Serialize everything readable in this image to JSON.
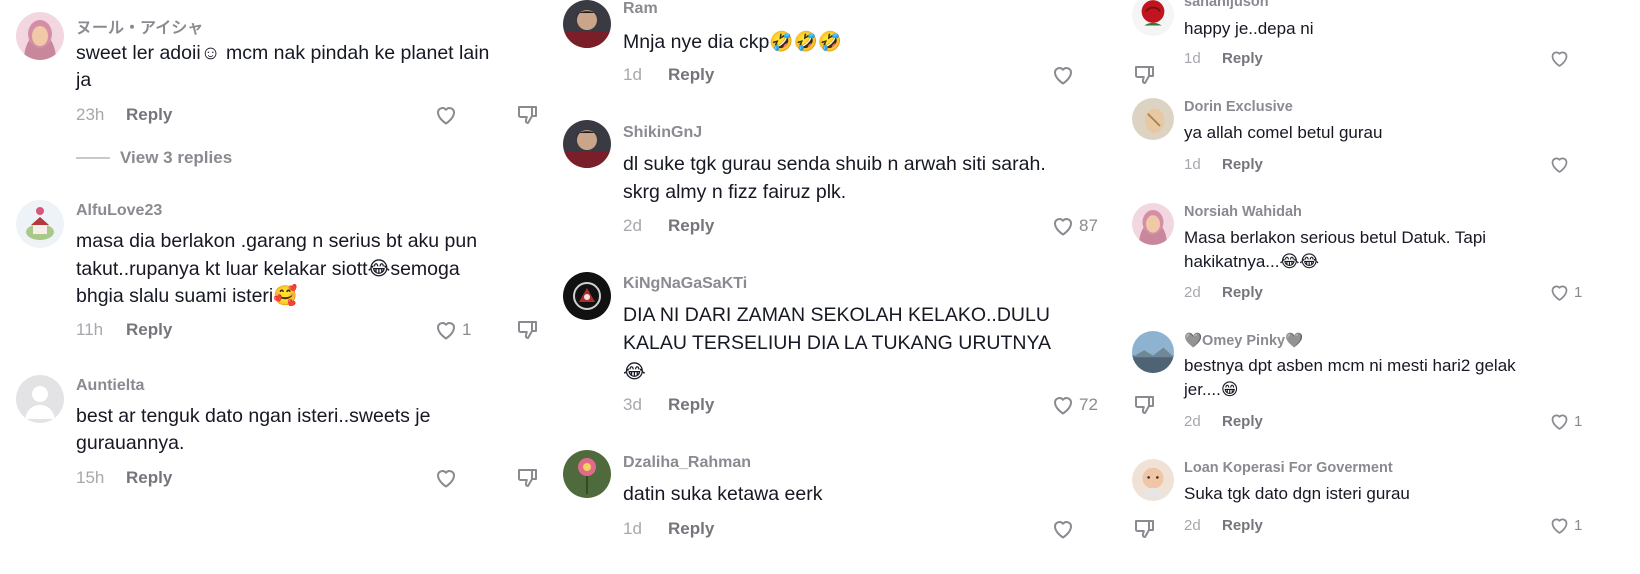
{
  "columns": [
    {
      "comments": [
        {
          "username": "ヌール・アイシャ",
          "lines": [
            "sweet ler adoii☺ mcm nak pindah ke planet lain",
            "ja"
          ],
          "time": "23h",
          "reply": "Reply",
          "likes": "",
          "view_replies": "View 3 replies",
          "avatar": "hijab-avatar"
        },
        {
          "username": "AlfuLove23",
          "lines": [
            "masa dia berlakon .garang n serius bt aku pun",
            "takut..rupanya kt luar kelakar siott😂semoga",
            "bhgia slalu suami isteri🥰"
          ],
          "time": "11h",
          "reply": "Reply",
          "likes": "1",
          "avatar": "house-avatar"
        },
        {
          "username": "Auntielta",
          "lines": [
            "best ar tenguk dato ngan isteri..sweets je",
            "gurauannya."
          ],
          "time": "15h",
          "reply": "Reply",
          "likes": "",
          "avatar": "default-avatar"
        }
      ]
    },
    {
      "comments": [
        {
          "username": "Ram",
          "lines": [
            "Mnja nye dia ckp🤣🤣🤣"
          ],
          "time": "1d",
          "reply": "Reply",
          "likes": "",
          "avatar": "person-avatar"
        },
        {
          "username": "ShikinGnJ",
          "lines": [
            "dl suke tgk gurau senda shuib n arwah siti sarah.",
            "skrg almy n fizz fairuz plk."
          ],
          "time": "2d",
          "reply": "Reply",
          "likes": "87",
          "avatar": "person-avatar"
        },
        {
          "username": "KiNgNaGaSaKTi",
          "lines": [
            "DIA NI DARI ZAMAN SEKOLAH KELAKO..DULU",
            "KALAU TERSELIUH DIA LA TUKANG URUTNYA",
            "😂"
          ],
          "time": "3d",
          "reply": "Reply",
          "likes": "72",
          "avatar": "logo-avatar"
        },
        {
          "username": "Dzaliha_Rahman",
          "lines": [
            "datin suka ketawa eerk"
          ],
          "time": "1d",
          "reply": "Reply",
          "likes": "",
          "avatar": "flower-avatar"
        }
      ]
    },
    {
      "comments": [
        {
          "username": "sahanijuson",
          "lines": [
            "happy je..depa ni"
          ],
          "time": "1d",
          "reply": "Reply",
          "likes": "",
          "avatar": "rose-avatar"
        },
        {
          "username": "Dorin Exclusive",
          "lines": [
            "ya allah comel betul gurau"
          ],
          "time": "1d",
          "reply": "Reply",
          "likes": "",
          "avatar": "hand-avatar"
        },
        {
          "username": "Norsiah Wahidah",
          "lines": [
            "Masa berlakon serious betul Datuk. Tapi",
            "hakikatnya...😂😂"
          ],
          "time": "2d",
          "reply": "Reply",
          "likes": "1",
          "avatar": "hijab-avatar"
        },
        {
          "username": "🩶Omey Pinky🩶",
          "lines": [
            "bestnya dpt asben mcm ni mesti hari2 gelak",
            "jer....😁"
          ],
          "time": "2d",
          "reply": "Reply",
          "likes": "1",
          "avatar": "landscape-avatar"
        },
        {
          "username": "Loan Koperasi For Goverment",
          "lines": [
            "Suka tgk dato dgn isteri gurau"
          ],
          "time": "2d",
          "reply": "Reply",
          "likes": "1",
          "avatar": "baby-avatar"
        }
      ]
    }
  ],
  "icons": {
    "like": "heart-outline-icon",
    "dislike": "thumbs-down-icon"
  },
  "colors": {
    "text": "#161823",
    "username": "#8a8b91",
    "meta": "#a7a8ad",
    "reply": "#75767c"
  }
}
